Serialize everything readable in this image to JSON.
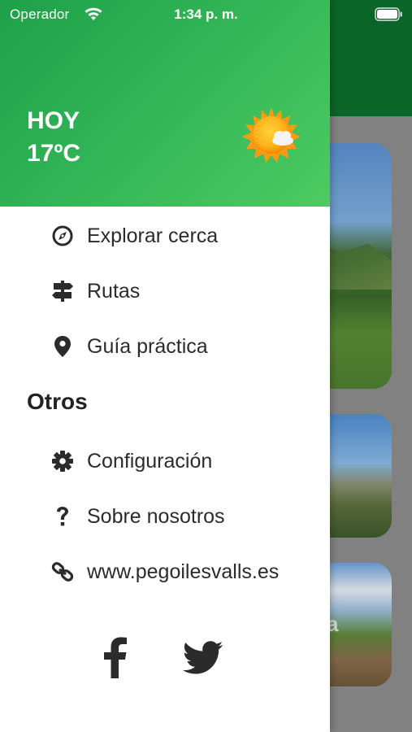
{
  "status_bar": {
    "carrier": "Operador",
    "time": "1:34 p. m.",
    "icons": [
      "wifi-icon",
      "battery-icon"
    ]
  },
  "weather": {
    "label": "HOY",
    "temperature": "17ºC",
    "icon": "sun-cloud-icon"
  },
  "menu": {
    "items": [
      {
        "label": "Explorar cerca",
        "icon": "compass-icon"
      },
      {
        "label": "Rutas",
        "icon": "signpost-icon"
      },
      {
        "label": "Guía práctica",
        "icon": "map-pin-icon"
      }
    ],
    "section_title": "Otros",
    "other_items": [
      {
        "label": "Configuración",
        "icon": "gear-icon"
      },
      {
        "label": "Sobre nosotros",
        "icon": "question-icon"
      },
      {
        "label": "www.pegoilesvalls.es",
        "icon": "link-icon"
      }
    ]
  },
  "social": [
    "facebook-icon",
    "twitter-icon"
  ],
  "colors": {
    "header_green": "#30b455",
    "app_bar_dark_green": "#0b6e2c",
    "text": "#2b2b2b"
  }
}
